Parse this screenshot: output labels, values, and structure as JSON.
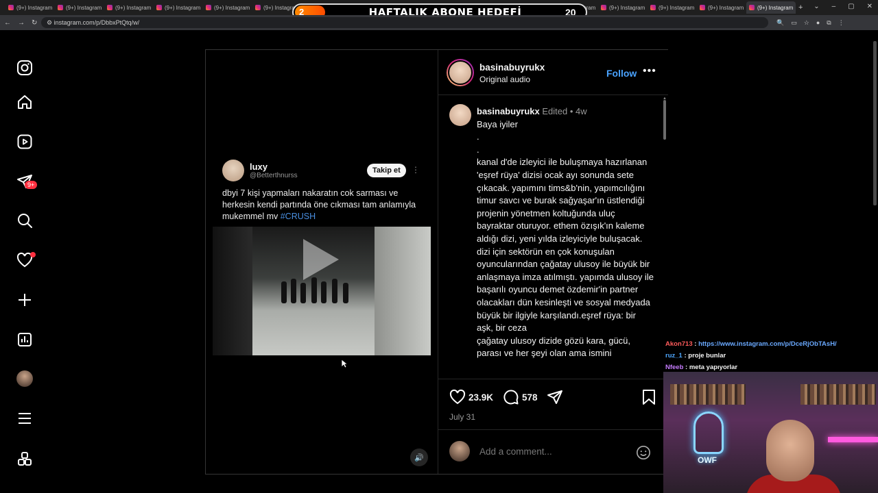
{
  "browser": {
    "tabs": [
      {
        "label": "(9+) Instagram"
      },
      {
        "label": "(9+) Instagram"
      },
      {
        "label": "(9+) Instagram"
      },
      {
        "label": "(9+) Instagram"
      },
      {
        "label": "(9+) Instagram"
      },
      {
        "label": "(9+) Instagram"
      },
      {
        "label": "(9+) Instagram"
      },
      {
        "label": "(9+) Instagram"
      },
      {
        "label": "(9+) Instagram"
      },
      {
        "label": "(9+) Instagram"
      },
      {
        "label": "(9+) Instagram"
      },
      {
        "label": "(9+) Instagram"
      },
      {
        "label": "(9+) Instagram"
      },
      {
        "label": "(9+) Instagram"
      },
      {
        "label": "(9+) Instagram"
      },
      {
        "label": "(9+) Instagram"
      }
    ],
    "url": "instagram.com/p/DbbxPtQtq/w/"
  },
  "banner": {
    "current": "2",
    "title": "HAFTALIK ABONE HEDEFİ",
    "goal": "20"
  },
  "sidebar": {
    "icons": [
      "instagram-logo-icon",
      "home-icon",
      "reels-icon",
      "messages-icon",
      "search-icon",
      "notifications-heart-icon",
      "create-plus-icon",
      "dashboard-icon",
      "profile-avatar",
      "more-menu-icon",
      "also-from-meta-icon"
    ],
    "messages_badge": "9+"
  },
  "tweet": {
    "name": "luxy",
    "handle": "@Betterthnurss",
    "follow_label": "Takip et",
    "text": "dbyi 7 kişi yapmaları nakaratın cok sarması ve herkesin kendi partında öne cıkması tam anlamıyla mukemmel mv ",
    "hashtag": "#CRUSH"
  },
  "post": {
    "author": "basinabuyrukx",
    "audio": "Original audio",
    "follow_label": "Follow",
    "caption_user": "basinabuyrukx",
    "caption_meta": "Edited • 4w",
    "caption_lines": [
      "Baya iyiler",
      ".",
      ".",
      "kanal d'de izleyici ile buluşmaya hazırlanan 'eşref rüya' dizisi ocak ayı sonunda sete çıkacak. yapımını tims&b'nin, yapımcılığını timur savcı ve burak sağyaşar'ın üstlendiği projenin yönetmen koltuğunda uluç bayraktar oturuyor. ethem özışık'ın kaleme aldığı dizi, yeni yılda izleyiciyle buluşacak. dizi için sektörün en çok konuşulan oyuncularından çağatay ulusoy ile büyük bir anlaşmaya imza atılmıştı. yapımda ulusoy ile başarılı oyuncu demet özdemir'in partner olacakları dün kesinleşti ve sosyal medyada büyük bir ilgiyle karşılandı.eşref rüya: bir aşk, bir ceza",
      "çağatay ulusoy dizide gözü kara, gücü, parası ve her şeyi olan ama ismini"
    ],
    "likes": "23.9K",
    "comments": "578",
    "date": "July 31",
    "comment_placeholder": "Add a comment..."
  },
  "stream_chat": [
    {
      "user": "Akon713",
      "message": "https://www.instagram.com/p/DceRjObTAsH/"
    },
    {
      "user": "ruz_1",
      "message": "proje bunlar"
    },
    {
      "user": "Nfeeb",
      "message": "meta yapıyorlar"
    }
  ],
  "webcam": {
    "neon_text": "OWF"
  }
}
